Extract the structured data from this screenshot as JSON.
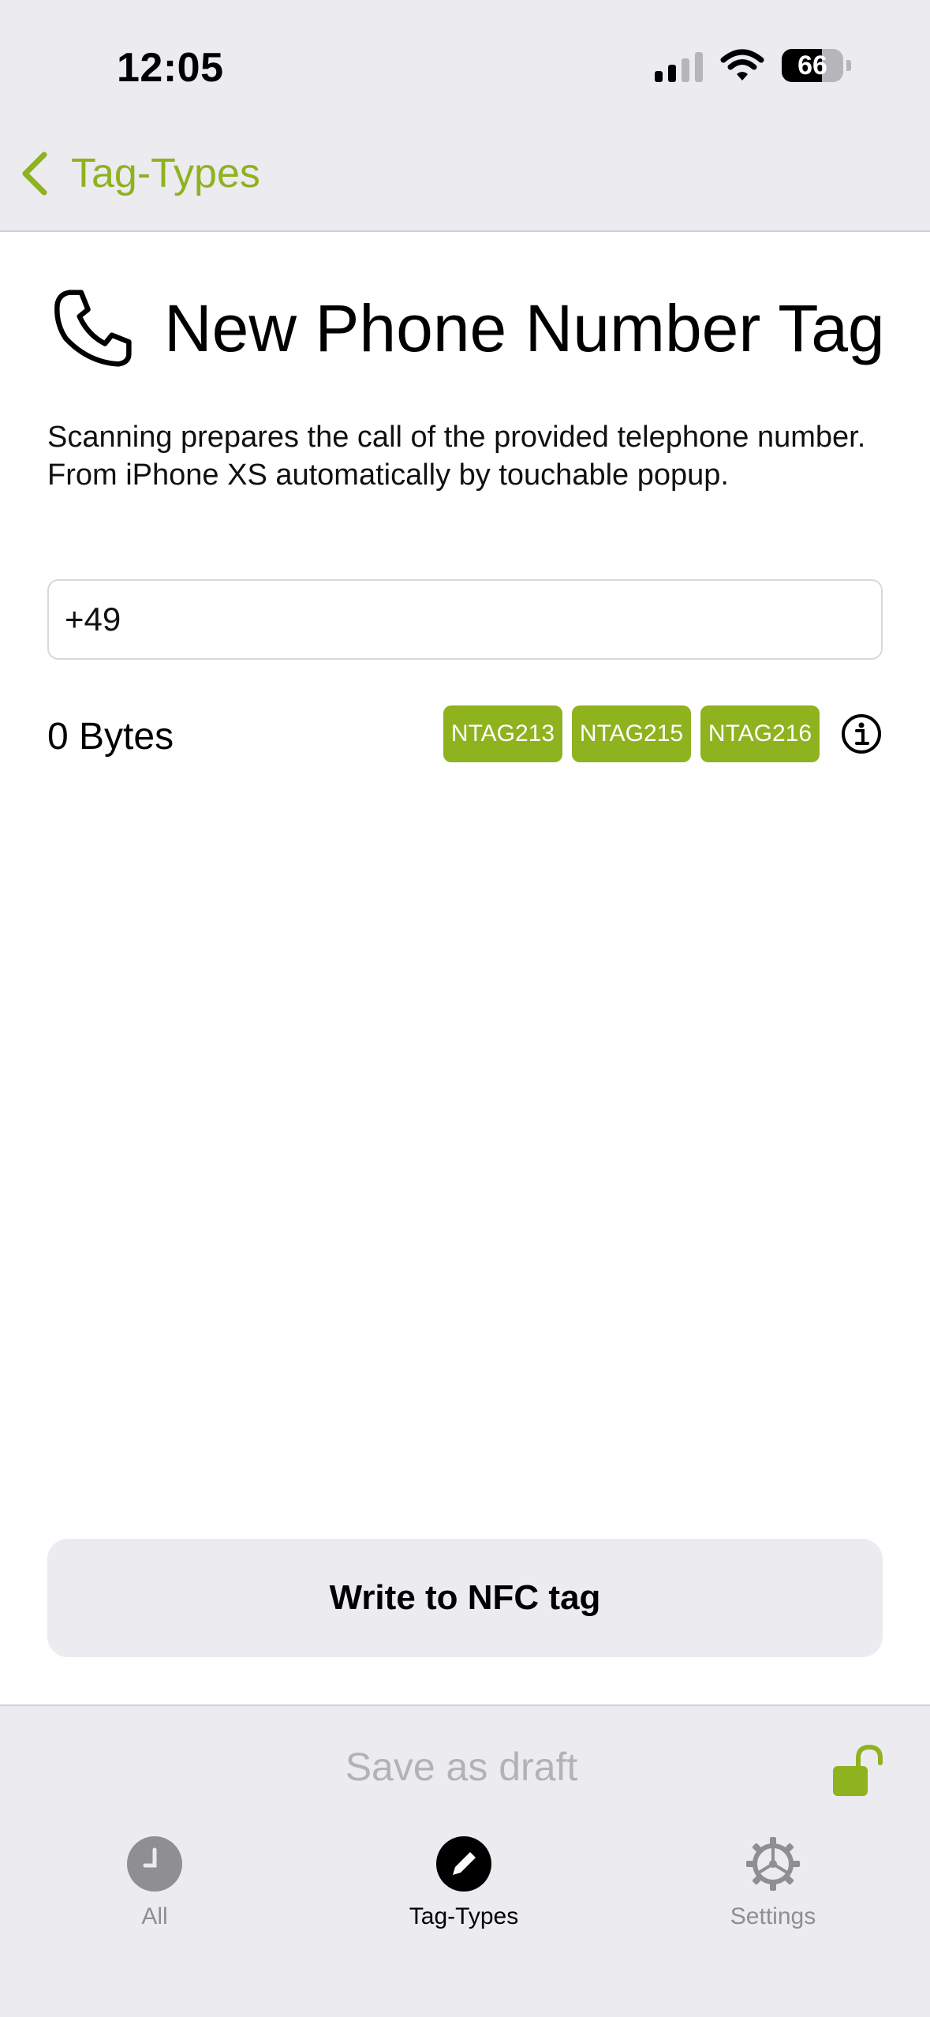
{
  "status_bar": {
    "time": "12:05",
    "battery": "66"
  },
  "nav": {
    "back_label": "Tag-Types"
  },
  "page": {
    "title": "New Phone Number Tag",
    "description": "Scanning prepares the call of the provided telephone number. From iPhone XS automatically by touchable popup.",
    "phone_value": "+49",
    "bytes": "0 Bytes",
    "tags": [
      "NTAG213",
      "NTAG215",
      "NTAG216"
    ]
  },
  "actions": {
    "write_label": "Write to NFC tag",
    "save_draft_label": "Save as draft"
  },
  "tabbar": {
    "items": [
      {
        "label": "All",
        "icon": "clock-icon",
        "active": false
      },
      {
        "label": "Tag-Types",
        "icon": "pencil-icon",
        "active": true
      },
      {
        "label": "Settings",
        "icon": "gear-icon",
        "active": false
      }
    ]
  },
  "colors": {
    "accent": "#8fb21f",
    "bar_background": "#ebebf0",
    "inactive": "#8e8e93"
  }
}
